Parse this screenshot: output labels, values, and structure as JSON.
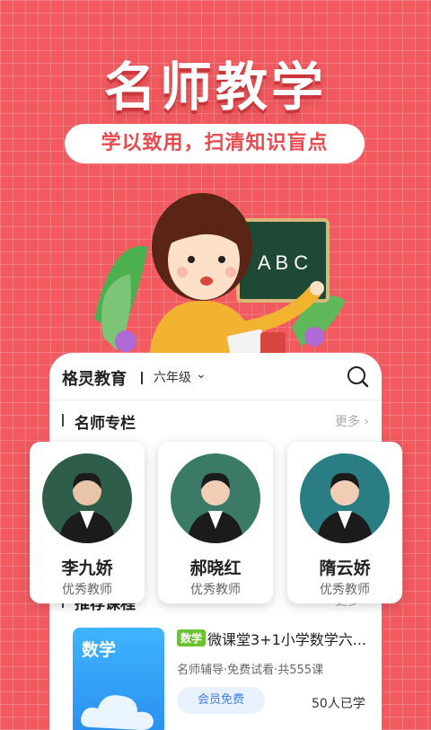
{
  "hero": {
    "headline": "名师教学",
    "tagline": "学以致用，扫清知识盲点",
    "board_text": "A B C"
  },
  "app": {
    "brand": "格灵教育",
    "grade": "六年级",
    "grade_chevron": "⌄",
    "search_icon": "search-icon"
  },
  "teachers_section": {
    "title": "名师专栏",
    "more": "更多 ›",
    "teachers": [
      {
        "name": "李九娇",
        "title": "优秀教师"
      },
      {
        "name": "郝晓红",
        "title": "优秀教师"
      },
      {
        "name": "隋云娇",
        "title": "优秀教师"
      }
    ]
  },
  "courses_section": {
    "title": "推荐课程",
    "more": "更多 ›",
    "course": {
      "cover_label": "数学",
      "subject_tag": "数学",
      "title": "微课堂3+1小学数学六...",
      "meta": "名师辅导·免费试看·共555课",
      "member_button": "会员免费",
      "learners": "50人已学"
    }
  },
  "colors": {
    "background": "#f25a5f",
    "accent": "#e84a50",
    "tag_green": "#6ac331",
    "cover_blue": "#2a8ff0"
  }
}
